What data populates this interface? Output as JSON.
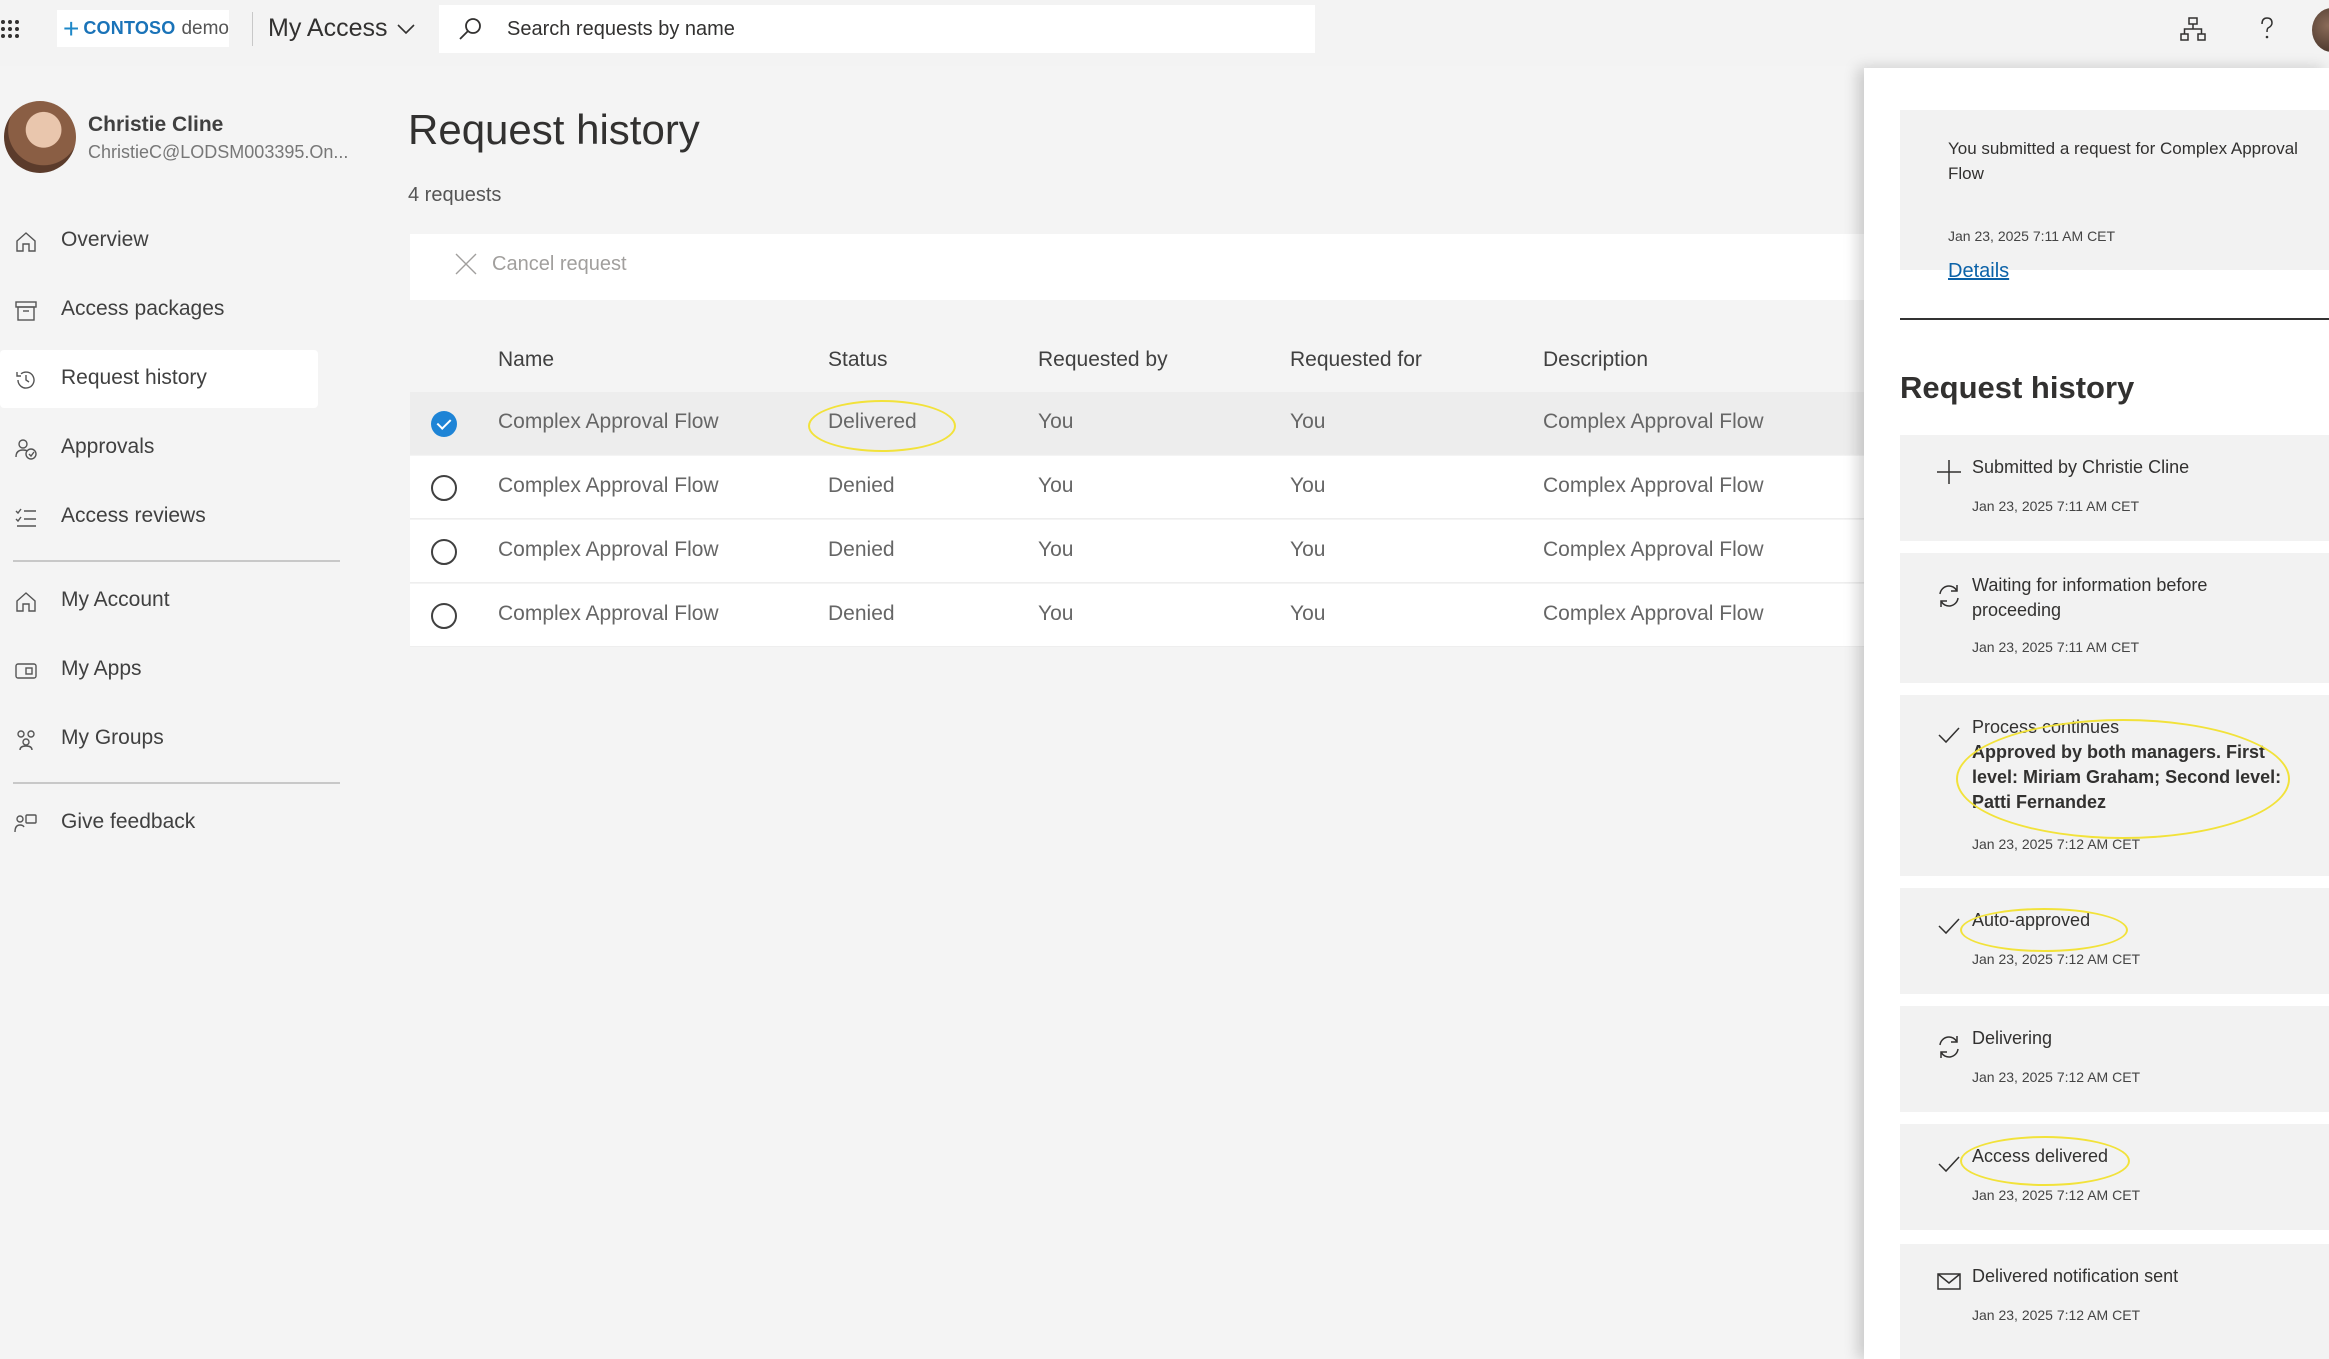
{
  "topbar": {
    "brand_name": "CONTOSO",
    "brand_suffix": "demo",
    "app_title": "My Access",
    "search_placeholder": "Search requests by name"
  },
  "user": {
    "name": "Christie Cline",
    "email": "ChristieC@LODSM003395.On..."
  },
  "sidebar": {
    "items": [
      {
        "label": "Overview",
        "icon": "home-icon"
      },
      {
        "label": "Access packages",
        "icon": "package-icon"
      },
      {
        "label": "Request history",
        "icon": "history-icon",
        "active": true
      },
      {
        "label": "Approvals",
        "icon": "approvals-icon"
      },
      {
        "label": "Access reviews",
        "icon": "reviews-icon"
      },
      {
        "label": "My Account",
        "icon": "account-icon"
      },
      {
        "label": "My Apps",
        "icon": "apps-icon"
      },
      {
        "label": "My Groups",
        "icon": "groups-icon"
      },
      {
        "label": "Give feedback",
        "icon": "feedback-icon"
      }
    ]
  },
  "main": {
    "title": "Request history",
    "count": "4 requests",
    "cancel_label": "Cancel request",
    "columns": [
      "Name",
      "Status",
      "Requested by",
      "Requested for",
      "Description"
    ],
    "rows": [
      {
        "name": "Complex Approval Flow",
        "status": "Delivered",
        "requested_by": "You",
        "requested_for": "You",
        "description": "Complex Approval Flow",
        "selected": true
      },
      {
        "name": "Complex Approval Flow",
        "status": "Denied",
        "requested_by": "You",
        "requested_for": "You",
        "description": "Complex Approval Flow",
        "selected": false
      },
      {
        "name": "Complex Approval Flow",
        "status": "Denied",
        "requested_by": "You",
        "requested_for": "You",
        "description": "Complex Approval Flow",
        "selected": false
      },
      {
        "name": "Complex Approval Flow",
        "status": "Denied",
        "requested_by": "You",
        "requested_for": "You",
        "description": "Complex Approval Flow",
        "selected": false
      }
    ]
  },
  "panel": {
    "summary_text": "You submitted a request for Complex Approval Flow",
    "summary_date": "Jan 23, 2025 7:11 AM CET",
    "details_link": "Details",
    "history_title": "Request history",
    "history": [
      {
        "icon": "plus-icon",
        "title": "Submitted by Christie Cline",
        "detail": "",
        "date": "Jan 23, 2025 7:11 AM CET"
      },
      {
        "icon": "refresh-icon",
        "title": "Waiting for information before proceeding",
        "detail": "",
        "date": "Jan 23, 2025 7:11 AM CET"
      },
      {
        "icon": "checkmark-icon",
        "title": "Process continues",
        "detail": "Approved by both managers. First level: Miriam Graham; Second level: Patti Fernandez",
        "date": "Jan 23, 2025 7:12 AM CET"
      },
      {
        "icon": "checkmark-icon",
        "title": "Auto-approved",
        "detail": "",
        "date": "Jan 23, 2025 7:12 AM CET"
      },
      {
        "icon": "refresh-icon",
        "title": "Delivering",
        "detail": "",
        "date": "Jan 23, 2025 7:12 AM CET"
      },
      {
        "icon": "checkmark-icon",
        "title": "Access delivered",
        "detail": "",
        "date": "Jan 23, 2025 7:12 AM CET"
      },
      {
        "icon": "mail-icon",
        "title": "Delivered notification sent",
        "detail": "",
        "date": "Jan 23, 2025 7:12 AM CET"
      }
    ]
  },
  "colors": {
    "accent": "#1e84d6",
    "link": "#0b62a8",
    "highlight": "#f2e23a"
  }
}
